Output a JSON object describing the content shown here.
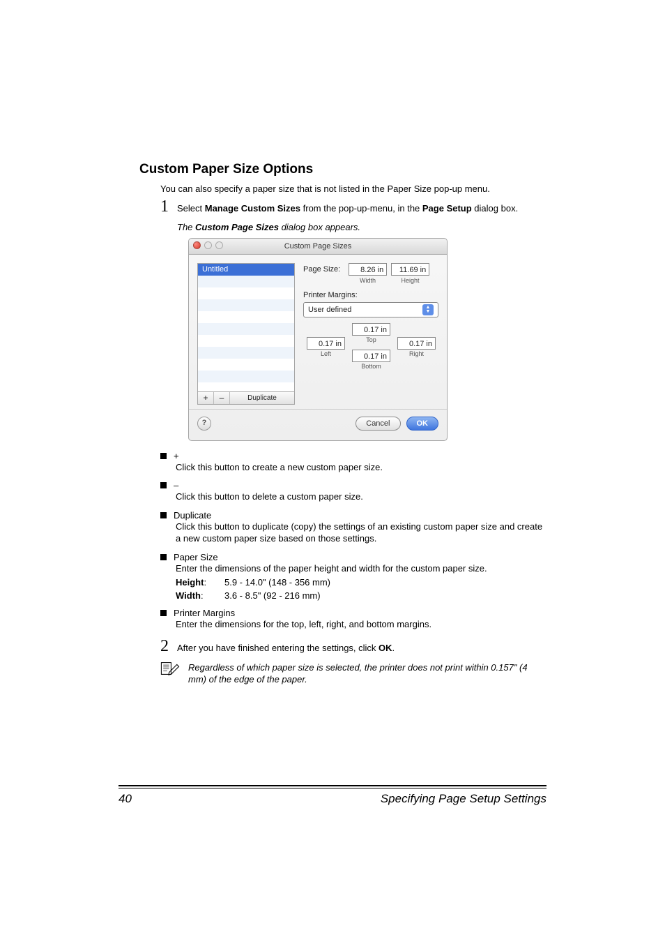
{
  "section_title": "Custom Paper Size Options",
  "intro": "You can also specify a paper size that is not listed in the Paper Size pop-up menu.",
  "step1": {
    "num": "1",
    "pre": "Select ",
    "bold1": "Manage Custom Sizes",
    "mid": " from the pop-up-menu, in the ",
    "bold2": "Page Setup",
    "post": " dialog box."
  },
  "caption_pre": "The ",
  "caption_bold": "Custom Page Sizes",
  "caption_post": " dialog box appears.",
  "dialog": {
    "title": "Custom Page Sizes",
    "list_item": "Untitled",
    "btn_plus": "+",
    "btn_minus": "–",
    "btn_dup": "Duplicate",
    "page_size_label": "Page Size:",
    "width_val": "8.26 in",
    "height_val": "11.69 in",
    "width_lbl": "Width",
    "height_lbl": "Height",
    "margins_label": "Printer Margins:",
    "margins_select": "User defined",
    "m_val": "0.17 in",
    "m_top": "Top",
    "m_left": "Left",
    "m_right": "Right",
    "m_bottom": "Bottom",
    "help": "?",
    "cancel": "Cancel",
    "ok": "OK"
  },
  "bullets": {
    "plus": {
      "head": "+",
      "body": "Click this button to create a new custom paper size."
    },
    "minus": {
      "head": "–",
      "body": "Click this button to delete a custom paper size."
    },
    "dup": {
      "head": "Duplicate",
      "body": "Click this button to duplicate (copy) the settings of an existing custom paper size and create a new custom paper size based on those settings."
    },
    "paper": {
      "head": "Paper Size",
      "body": "Enter the dimensions of the paper height and width for the custom paper size."
    },
    "height_k": "Height",
    "height_v": "5.9 - 14.0\" (148 - 356 mm)",
    "width_k": "Width",
    "width_v": "3.6 - 8.5\" (92 - 216 mm)",
    "pm": {
      "head": "Printer Margins",
      "body": "Enter the dimensions for the top, left, right, and bottom margins."
    }
  },
  "step2": {
    "num": "2",
    "pre": "After you have finished entering the settings, click ",
    "bold": "OK",
    "post": "."
  },
  "note": "Regardless of which paper size is selected, the printer does not print within 0.157\" (4 mm) of the edge of the paper.",
  "footer": {
    "page": "40",
    "title": "Specifying Page Setup Settings"
  }
}
